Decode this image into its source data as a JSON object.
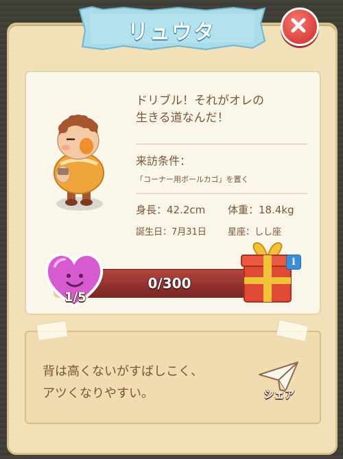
{
  "character": {
    "name": "リュウタ",
    "quote_line1": "ドリブル！それがオレの",
    "quote_line2": "生きる道なんだ！",
    "visit_condition_label": "来訪条件：",
    "visit_condition_value": "「コーナー用ボールカゴ」を置く",
    "height": "身長：42.2cm",
    "weight": "体重：18.4kg",
    "birthday": "誕生日：7月31日",
    "zodiac": "星座：しし座",
    "description_line1": "背は高くないがすばしこく、",
    "description_line2": "アツくなりやすい。"
  },
  "progress": {
    "text": "0/300",
    "current": 0,
    "max": 300,
    "heart_level": "1/5"
  },
  "actions": {
    "share_label": "シェア"
  },
  "icons": {
    "close": "close-icon",
    "heart": "heart-smile-icon",
    "gift": "gift-box-icon",
    "info": "info-icon",
    "share": "paper-plane-icon"
  },
  "colors": {
    "panel": "#f1e0b8",
    "card": "#fbf6ea",
    "text": "#7a5535",
    "ribbon": "#a9dbe8",
    "close": "#d9413d",
    "progress": "#943230",
    "heart": "#d75ad0"
  }
}
